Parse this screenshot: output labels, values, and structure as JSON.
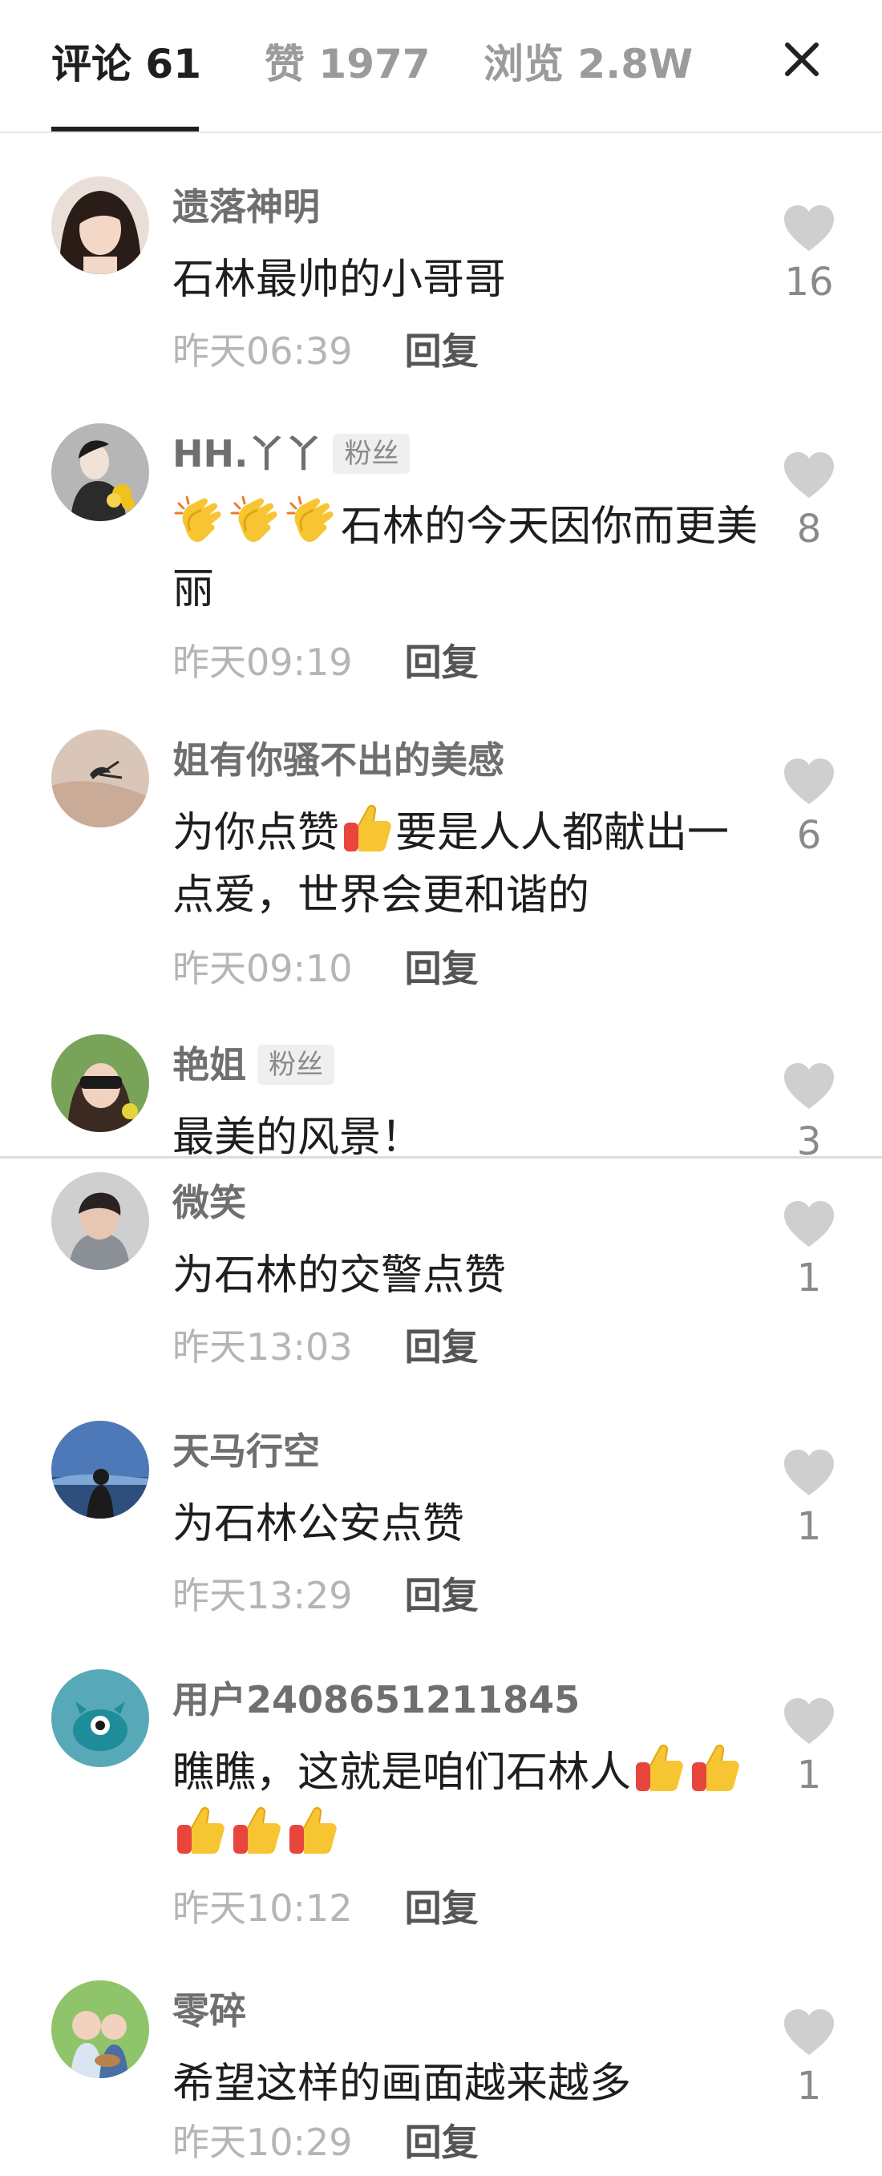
{
  "tabs": {
    "comments": "评论 61",
    "likes": "赞 1977",
    "views": "浏览 2.8W"
  },
  "reply_label": "回复",
  "fan_badge": "粉丝",
  "comments": [
    {
      "username": "遗落神明",
      "text": "石林最帅的小哥哥",
      "time": "昨天06:39",
      "likes": "16"
    },
    {
      "username": "HH.丫丫",
      "text": "石林的今天因你而更美丽",
      "time": "昨天09:19",
      "likes": "8",
      "badge": "粉丝",
      "emoji": "clapping-hands x3"
    },
    {
      "username": "姐有你骚不出的美感",
      "text_before": "为你点赞",
      "text_after": "要是人人都献出一点爱，世界会更和谐的",
      "time": "昨天09:10",
      "likes": "6",
      "emoji": "thumbs-up"
    },
    {
      "username": "艳姐",
      "text": "最美的风景！",
      "likes": "3",
      "badge": "粉丝"
    },
    {
      "username": "微笑",
      "text": "为石林的交警点赞",
      "time": "昨天13:03",
      "likes": "1"
    },
    {
      "username": "天马行空",
      "text": "为石林公安点赞",
      "time": "昨天13:29",
      "likes": "1"
    },
    {
      "username": "用户2408651211845",
      "text": "瞧瞧，这就是咱们石林人",
      "time": "昨天10:12",
      "likes": "1",
      "emoji": "thumbs-up x5"
    },
    {
      "username": "零碎",
      "text": "希望这样的画面越来越多",
      "time": "昨天10:29",
      "likes": "1"
    }
  ],
  "colors": {
    "like_icon": "#cfcfcf",
    "timestamp": "#b5b5b5",
    "username": "#6f6f6f",
    "active_tab": "#1f1f1f",
    "inactive_tab": "#9b9b9b"
  }
}
